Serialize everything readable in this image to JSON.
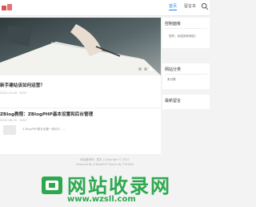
{
  "header": {
    "nav": {
      "home": "首页",
      "message": "留言本"
    }
  },
  "banner": {
    "slides": 3,
    "active_slide": 2
  },
  "posts": [
    {
      "title": "新手建站该如何运营？",
      "meta": "2022-10-08 · 4537"
    },
    {
      "title": "ZBlog教程：ZBlogPHP基本设置和后台管理",
      "meta": "2022-08-15 · 3451",
      "excerpt": "Z-BlogPHP基本设置一般用于……"
    }
  ],
  "sidebar": {
    "control": {
      "title": "控制面板",
      "text": "您好，欢迎到访网站！"
    },
    "categories": {
      "title": "网站分类",
      "item": "未分类"
    },
    "recent": {
      "title": "最新留言"
    }
  },
  "footer": {
    "line1": "网站备案号：暂无  |  Copyright © 2022",
    "line2": "Powered By Z-BlogPHP  Theme By TOYEAN"
  },
  "watermark": {
    "text": "网站收录网",
    "url": "www.wzsll.com"
  }
}
